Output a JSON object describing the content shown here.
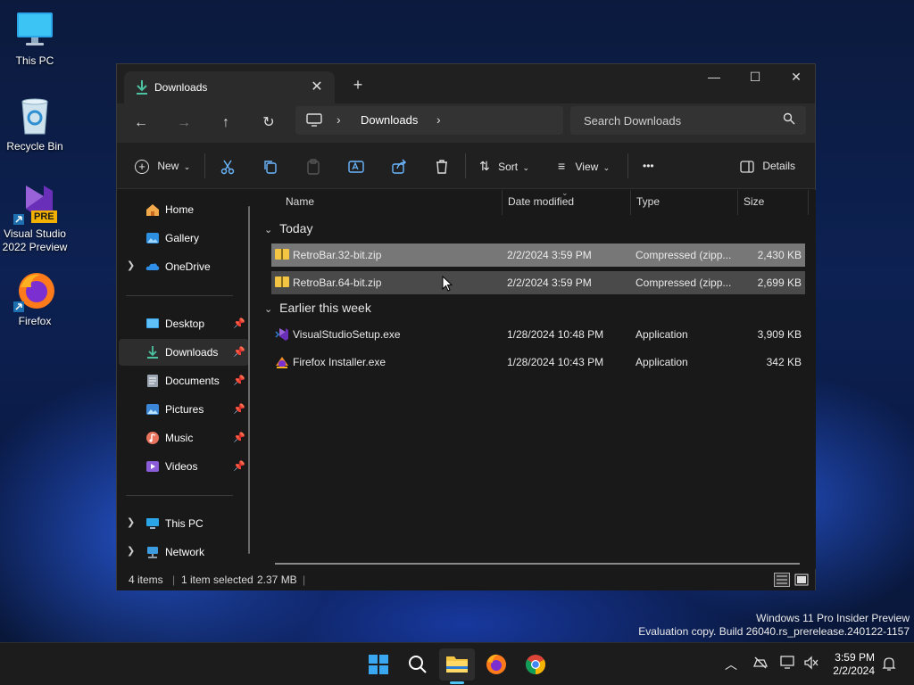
{
  "desktop": {
    "icons": [
      {
        "label": "This PC",
        "icon": "this-pc-icon"
      },
      {
        "label": "Recycle Bin",
        "icon": "recycle-bin-icon"
      },
      {
        "label": "Visual Studio 2022 Preview",
        "icon": "visual-studio-icon",
        "badge": "PRE"
      },
      {
        "label": "Firefox",
        "icon": "firefox-icon"
      }
    ],
    "watermark": {
      "line1": "Windows 11 Pro Insider Preview",
      "line2": "Evaluation copy. Build 26040.rs_prerelease.240122-1157"
    }
  },
  "window": {
    "tab_title": "Downloads",
    "tab_close": "✕",
    "new_tab": "+",
    "controls": {
      "minimize": "—",
      "maximize": "☐",
      "close": "✕"
    },
    "address": {
      "root_icon": "monitor-icon",
      "sep": "›",
      "current": "Downloads"
    },
    "search_placeholder": "Search Downloads",
    "toolbar": {
      "new": "New",
      "sort": "Sort",
      "view": "View",
      "more": "•••",
      "details": "Details"
    },
    "sidebar": {
      "items": [
        {
          "label": "Home",
          "icon": "home-icon"
        },
        {
          "label": "Gallery",
          "icon": "gallery-icon"
        },
        {
          "label": "OneDrive",
          "icon": "onedrive-icon"
        },
        {
          "label": "Desktop",
          "icon": "desktop-folder-icon"
        },
        {
          "label": "Downloads",
          "icon": "downloads-icon"
        },
        {
          "label": "Documents",
          "icon": "documents-icon"
        },
        {
          "label": "Pictures",
          "icon": "pictures-icon"
        },
        {
          "label": "Music",
          "icon": "music-icon"
        },
        {
          "label": "Videos",
          "icon": "videos-icon"
        },
        {
          "label": "This PC",
          "icon": "this-pc-icon"
        },
        {
          "label": "Network",
          "icon": "network-icon"
        }
      ],
      "selected": "Downloads"
    },
    "columns": [
      "Name",
      "Date modified",
      "Type",
      "Size"
    ],
    "groups": [
      {
        "title": "Today",
        "files": [
          {
            "name": "RetroBar.32-bit.zip",
            "date": "2/2/2024 3:59 PM",
            "type": "Compressed (zipp...",
            "size": "2,430 KB",
            "icon": "zip-folder-icon"
          },
          {
            "name": "RetroBar.64-bit.zip",
            "date": "2/2/2024 3:59 PM",
            "type": "Compressed (zipp...",
            "size": "2,699 KB",
            "icon": "zip-folder-icon"
          }
        ]
      },
      {
        "title": "Earlier this week",
        "files": [
          {
            "name": "VisualStudioSetup.exe",
            "date": "1/28/2024 10:48 PM",
            "type": "Application",
            "size": "3,909 KB",
            "icon": "visual-studio-setup-icon"
          },
          {
            "name": "Firefox Installer.exe",
            "date": "1/28/2024 10:43 PM",
            "type": "Application",
            "size": "342 KB",
            "icon": "firefox-installer-icon"
          }
        ]
      }
    ],
    "status": {
      "count": "4 items",
      "selection": "1 item selected",
      "size": "2.37 MB"
    }
  },
  "taskbar": {
    "clock_time": "3:59 PM",
    "clock_date": "2/2/2024"
  },
  "colors": {
    "accent": "#0078d4",
    "download_green": "#4cc2a0",
    "folder_yellow": "#f4c542"
  }
}
